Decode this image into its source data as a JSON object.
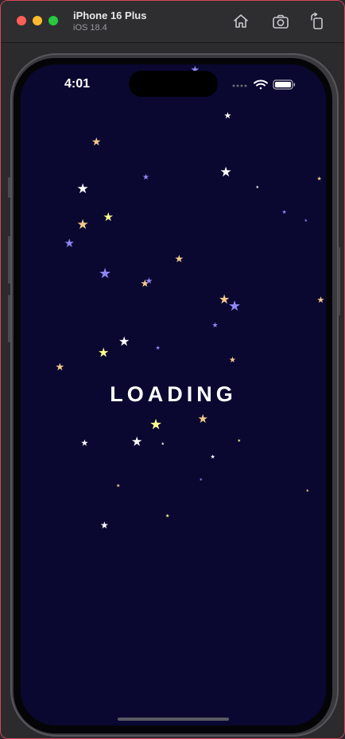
{
  "window": {
    "device_name": "iPhone 16 Plus",
    "os_version": "iOS 18.4",
    "toolbar_icons": [
      "home-icon",
      "screenshot-icon",
      "rotate-icon"
    ]
  },
  "status_bar": {
    "time": "4:01",
    "icons": [
      "cellular-icon",
      "wifi-icon",
      "battery-icon"
    ]
  },
  "screen": {
    "loading_text": "LOADING",
    "background": "#0a0830"
  },
  "colors": {
    "star_white": "#ffffff",
    "star_peach": "#f5c98a",
    "star_yellow": "#fbfb8e",
    "star_violet": "#8f86f5"
  }
}
